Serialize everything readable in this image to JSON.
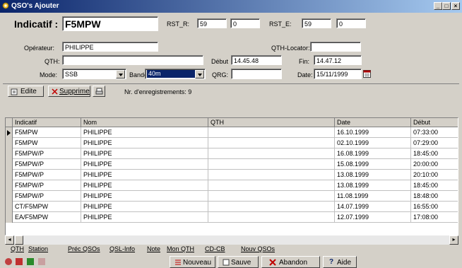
{
  "window": {
    "title": "QSO's Ajouter",
    "min": "_",
    "max": "□",
    "close": "×"
  },
  "form": {
    "indicatif_label": "Indicatif :",
    "indicatif_value": "F5MPW",
    "rst_r_label": "RST_R:",
    "rst_r_1": "59",
    "rst_r_2": "0",
    "rst_e_label": "RST_E:",
    "rst_e_1": "59",
    "rst_e_2": "0",
    "operateur_label": "Opérateur:",
    "operateur_value": "PHILIPPE",
    "qth_locator_label": "QTH-Locator:",
    "qth_locator_value": "",
    "qth_label": "QTH:",
    "qth_value": "",
    "debut_label": "Début",
    "debut_value": "14.45.48",
    "fin_label": "Fin:",
    "fin_value": "14.47.12",
    "mode_label": "Mode:",
    "mode_value": "SSB",
    "bande_label": "Bande:",
    "bande_value": "40m",
    "qrg_label": "QRG:",
    "qrg_value": "",
    "date_label": "Date:",
    "date_value": "15/11/1999"
  },
  "toolbar": {
    "edite": "Edite",
    "supprime": "Supprime",
    "records": "Nr. d'enregistrements: 9"
  },
  "table": {
    "headers": [
      "Indicatif",
      "Nom",
      "QTH",
      "Date",
      "Début"
    ],
    "rows": [
      [
        "F5MPW",
        "PHILIPPE",
        "",
        "16.10.1999",
        "07:33:00"
      ],
      [
        "F5MPW",
        "PHILIPPE",
        "",
        "02.10.1999",
        "07:29:00"
      ],
      [
        "F5MPW/P",
        "PHILIPPE",
        "",
        "16.08.1999",
        "18:45:00"
      ],
      [
        "F5MPW/P",
        "PHILIPPE",
        "",
        "15.08.1999",
        "20:00:00"
      ],
      [
        "F5MPW/P",
        "PHILIPPE",
        "",
        "13.08.1999",
        "20:10:00"
      ],
      [
        "F5MPW/P",
        "PHILIPPE",
        "",
        "13.08.1999",
        "18:45:00"
      ],
      [
        "F5MPW/P",
        "PHILIPPE",
        "",
        "11.08.1999",
        "18:48:00"
      ],
      [
        "CT/F5MPW",
        "PHILIPPE",
        "",
        "14.07.1999",
        "16:55:00"
      ],
      [
        "EA/F5MPW",
        "PHILIPPE",
        "",
        "12.07.1999",
        "17:08:00"
      ]
    ]
  },
  "tabs": [
    "QTH",
    "Station",
    "Préc QSOs",
    "QSL-Info",
    "Note",
    "Mon QTH",
    "CD-CB",
    "Nouv QSOs"
  ],
  "bottom": {
    "nouveau": "Nouveau",
    "sauve": "Sauve",
    "abandon": "Abandon",
    "aide": "Aide"
  }
}
